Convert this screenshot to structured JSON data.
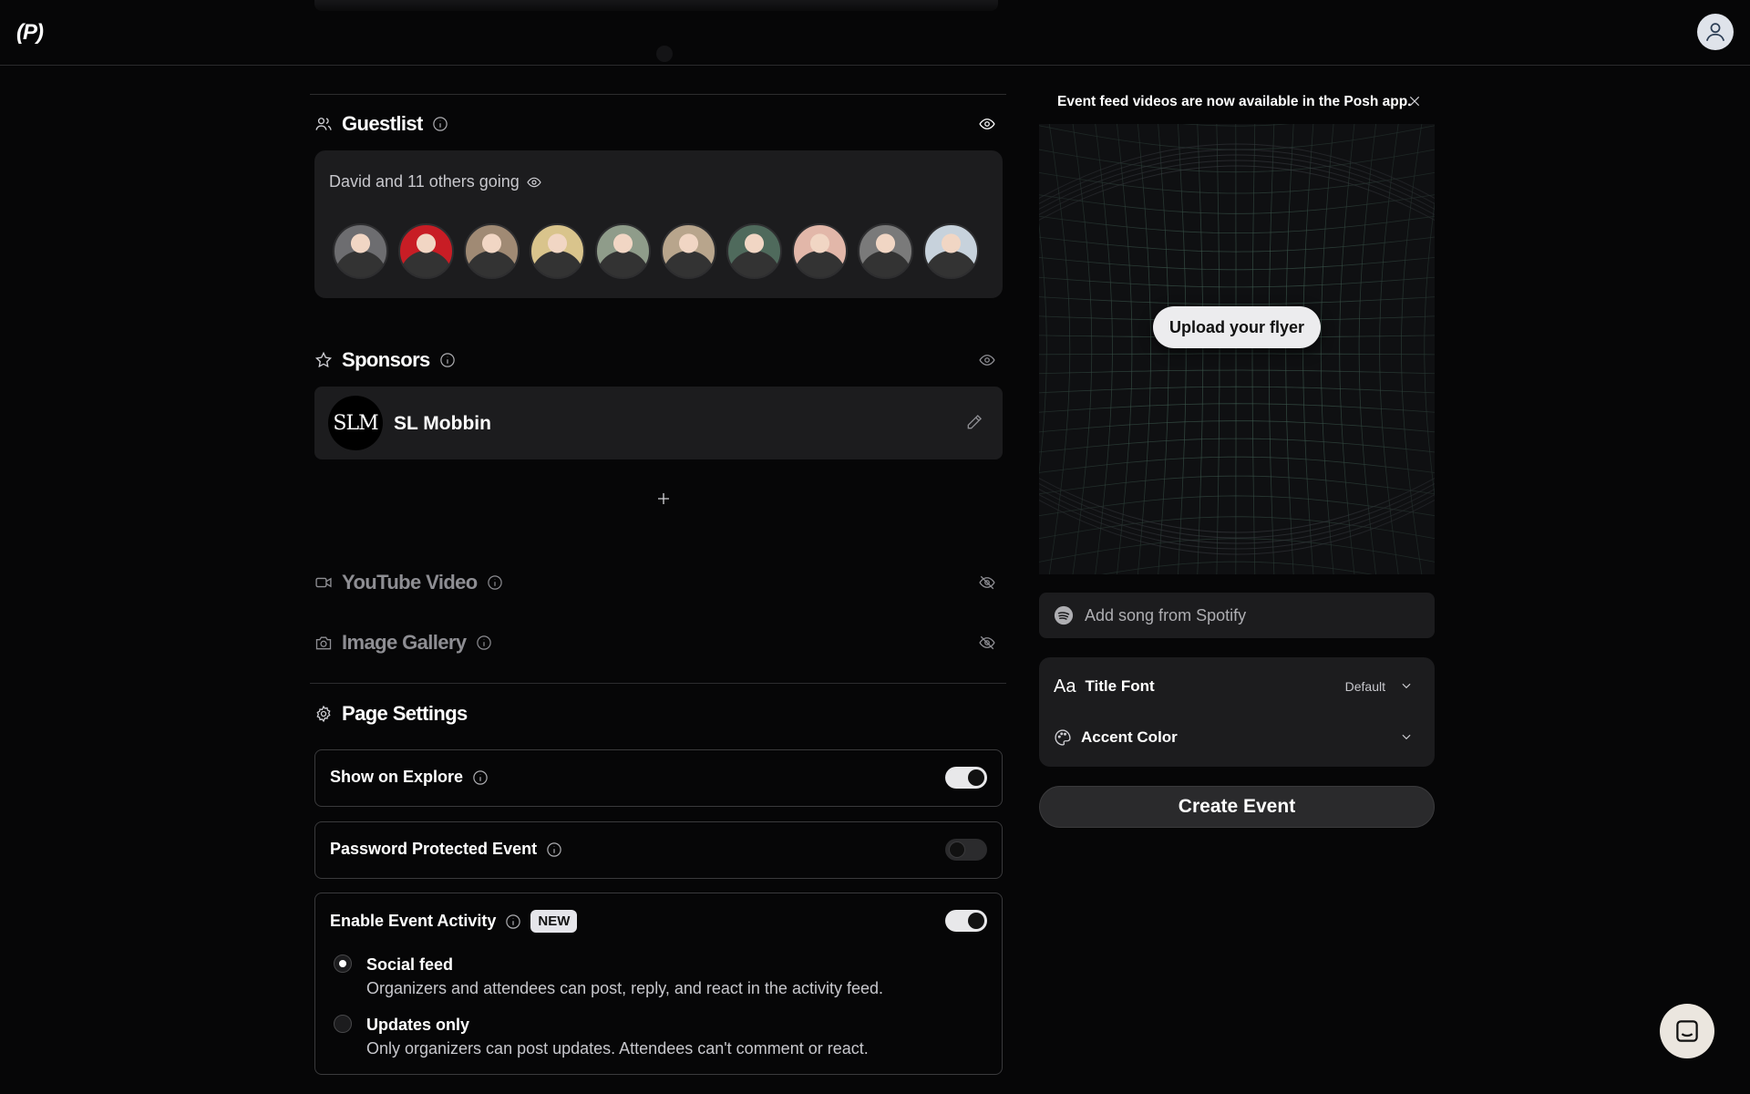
{
  "app": {
    "logo": "(P)"
  },
  "guestlist": {
    "title": "Guestlist",
    "summary": "David and 11 others going",
    "avatars": [
      {
        "bg": "#6d6d70"
      },
      {
        "bg": "#c81d25"
      },
      {
        "bg": "#a08a74"
      },
      {
        "bg": "#d9c48c"
      },
      {
        "bg": "#8f9c8a"
      },
      {
        "bg": "#b8a58c"
      },
      {
        "bg": "#4f6a5c"
      },
      {
        "bg": "#e2b7a9"
      },
      {
        "bg": "#7a7a7a"
      },
      {
        "bg": "#c7d2dc"
      }
    ]
  },
  "sponsors": {
    "title": "Sponsors",
    "items": [
      {
        "logo_text": "SLM",
        "name": "SL Mobbin"
      }
    ]
  },
  "youtube": {
    "title": "YouTube Video"
  },
  "gallery": {
    "title": "Image Gallery"
  },
  "page_settings": {
    "title": "Page Settings",
    "show_on_explore": {
      "label": "Show on Explore",
      "enabled": true
    },
    "password_protected": {
      "label": "Password Protected Event",
      "enabled": false
    },
    "event_activity": {
      "label": "Enable Event Activity",
      "badge": "NEW",
      "enabled": true,
      "options": [
        {
          "title": "Social feed",
          "desc": "Organizers and attendees can post, reply, and react in the activity feed.",
          "selected": true
        },
        {
          "title": "Updates only",
          "desc": "Only organizers can post updates. Attendees can't comment or react.",
          "selected": false
        }
      ]
    }
  },
  "sidebar": {
    "banner": "Event feed videos are now available in the Posh app.",
    "flyer_button": "Upload your flyer",
    "spotify_placeholder": "Add song from Spotify",
    "title_font": {
      "label": "Title Font",
      "icon_text": "Aa",
      "value": "Default"
    },
    "accent_color": {
      "label": "Accent Color"
    },
    "create_button": "Create Event"
  },
  "colors": {
    "accent": "#e8e8ea",
    "background": "#060607",
    "card": "#1c1c1e"
  }
}
